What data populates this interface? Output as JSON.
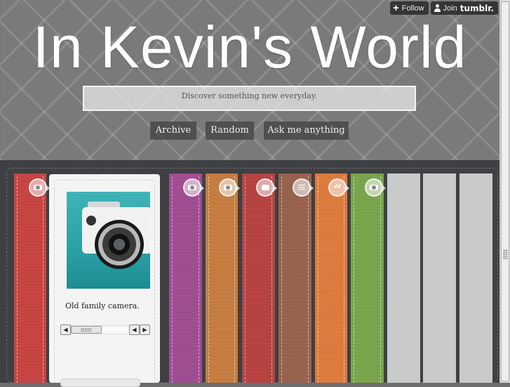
{
  "tumblr_controls": {
    "follow_label": "Follow",
    "join_label": "Join",
    "brand": "tumblr."
  },
  "header": {
    "title": "In Kevin's World",
    "tagline": "Discover something new everyday."
  },
  "nav": [
    {
      "label": "Archive"
    },
    {
      "label": "Random"
    },
    {
      "label": "Ask me anything"
    }
  ],
  "strips": [
    {
      "color": "#c8423f",
      "icon": "camera-icon"
    },
    {
      "color": "#a04a92",
      "icon": "camera-icon"
    },
    {
      "color": "#c77c3d",
      "icon": "camera-icon"
    },
    {
      "color": "#b8403d",
      "icon": "video-icon"
    },
    {
      "color": "#98614a",
      "icon": "text-icon"
    },
    {
      "color": "#e07a3a",
      "icon": "quote-icon"
    },
    {
      "color": "#78a64a",
      "icon": "camera-icon"
    },
    {
      "color": "#c9cbcb",
      "icon": ""
    },
    {
      "color": "#c9cbcb",
      "icon": ""
    },
    {
      "color": "#c9cbcb",
      "icon": ""
    }
  ],
  "post": {
    "caption": "Old family camera.",
    "photo_alt": "camera-photo"
  },
  "colors": {
    "content_bg": "#3e4043",
    "header_bg": "#7d7d7d"
  }
}
